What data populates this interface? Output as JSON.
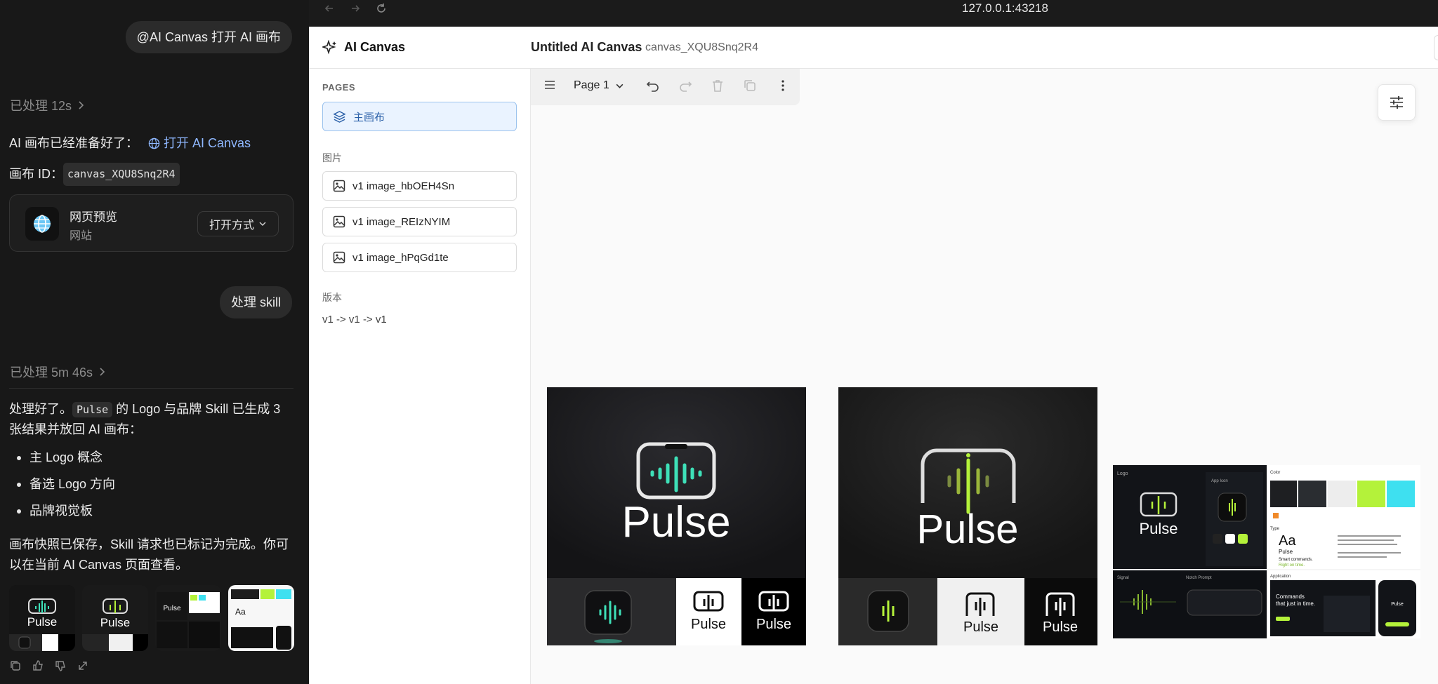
{
  "chat": {
    "user_msg_1": "@AI Canvas 打开 AI 画布",
    "processed_1": "已处理 12s",
    "ready_text": "AI 画布已经准备好了：",
    "open_link": "打开 AI Canvas",
    "canvas_id_label": "画布 ID：",
    "canvas_id": "canvas_XQU8Snq2R4",
    "preview_card": {
      "title": "网页预览",
      "subtitle": "网站",
      "open_with": "打开方式"
    },
    "user_msg_2": "处理 skill",
    "processed_2": "已处理 5m 46s",
    "result_pre": "处理好了。",
    "result_code": "Pulse",
    "result_line1_post": " 的 Logo 与品牌 Skill 已生成 3",
    "result_line2": "张结果并放回 AI 画布：",
    "bullets": [
      "主 Logo 概念",
      "备选 Logo 方向",
      "品牌视觉板"
    ],
    "closing_line1": "画布快照已保存，Skill 请求也已标记为完成。你可",
    "closing_line2": "以在当前 AI Canvas 页面查看。"
  },
  "browser": {
    "url": "127.0.0.1:43218",
    "app_name": "AI Canvas",
    "canvas_title": "Untitled AI Canvas",
    "canvas_id": "canvas_XQU8Snq2R4",
    "sidebar": {
      "pages_label": "PAGES",
      "main_page": "主画布",
      "images_label": "图片",
      "images": [
        "v1 image_hbOEH4Sn",
        "v1 image_REIzNYIM",
        "v1 image_hPqGd1te"
      ],
      "version_label": "版本",
      "version_chain": "v1 -> v1 -> v1"
    },
    "toolbar": {
      "page_select": "Page 1"
    }
  },
  "canvas_images": {
    "brand": "Pulse",
    "board_logo_caption": "Logo",
    "board_app_icon": "App Icon",
    "board_color": "Color",
    "board_type": "Type",
    "board_type_sample": "Aa",
    "board_type_name": "Pulse",
    "board_tagline_1": "Smart commands.",
    "board_tagline_2": "Right on time.",
    "board_signal": "Signal",
    "board_notch": "Notch Prompt",
    "board_application": "Application",
    "board_headline_1": "Commands",
    "board_headline_2": "that just in time."
  },
  "colors": {
    "accent_teal": "#3ee0b8",
    "accent_lime": "#b4f23a",
    "link": "#8fb8ff",
    "selected_bg": "#eaf3ff",
    "selected_border": "#9cc3ee"
  }
}
